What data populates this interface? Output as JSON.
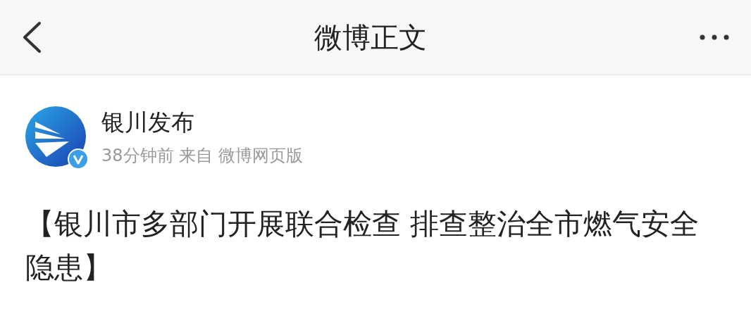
{
  "header": {
    "title": "微博正文"
  },
  "post": {
    "author": {
      "name": "银川发布",
      "verified": true
    },
    "meta": "38分钟前 来自 微博网页版",
    "text": "【银川市多部门开展联合检查 排查整治全市燃气安全隐患】"
  }
}
